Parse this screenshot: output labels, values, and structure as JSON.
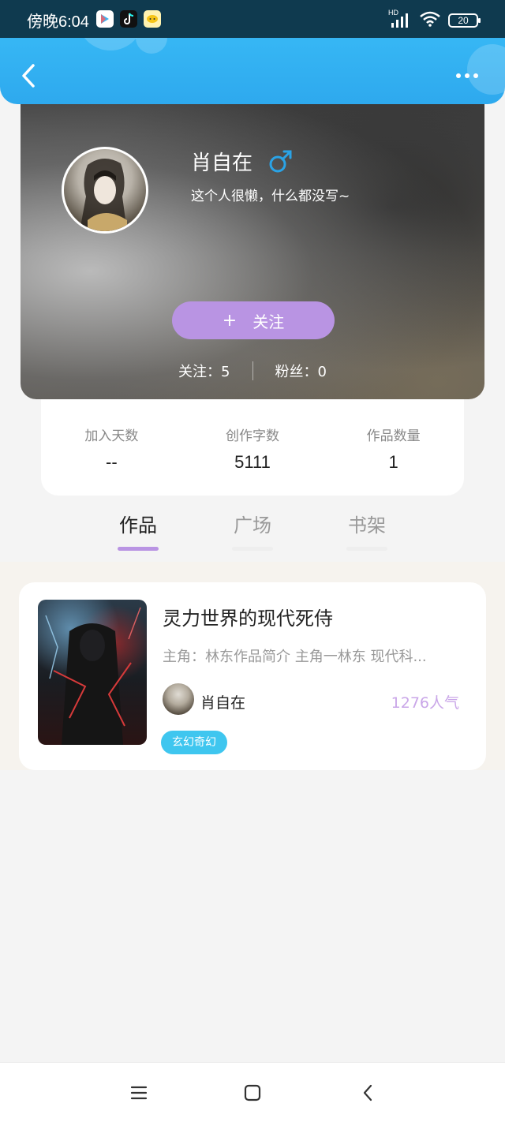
{
  "status_bar": {
    "time": "傍晚6:04",
    "battery": "20",
    "signal_label": "HD"
  },
  "header": {
    "back_icon": "chevron-left-icon",
    "more_icon": "more-dots-icon"
  },
  "profile": {
    "name": "肖自在",
    "gender_icon": "male-icon",
    "bio": "这个人很懒，什么都没写~",
    "follow_button": {
      "plus": "+",
      "label": "关注"
    },
    "following": "关注：5",
    "followers": "粉丝：0"
  },
  "stats": [
    {
      "label": "加入天数",
      "value": "--"
    },
    {
      "label": "创作字数",
      "value": "5111"
    },
    {
      "label": "作品数量",
      "value": "1"
    }
  ],
  "tabs": [
    {
      "label": "作品",
      "active": true
    },
    {
      "label": "广场",
      "active": false
    },
    {
      "label": "书架",
      "active": false
    }
  ],
  "works": [
    {
      "title": "灵力世界的现代死侍",
      "description": "主角：林东作品简介 主角一林东 现代科...",
      "author": "肖自在",
      "popularity": "1276人气",
      "tag": "玄幻奇幻"
    }
  ],
  "colors": {
    "header_blue": "#36b6f4",
    "accent_purple": "#b994e3",
    "tag_cyan": "#3fc6ef",
    "popularity_purple": "#c9a6e8"
  }
}
